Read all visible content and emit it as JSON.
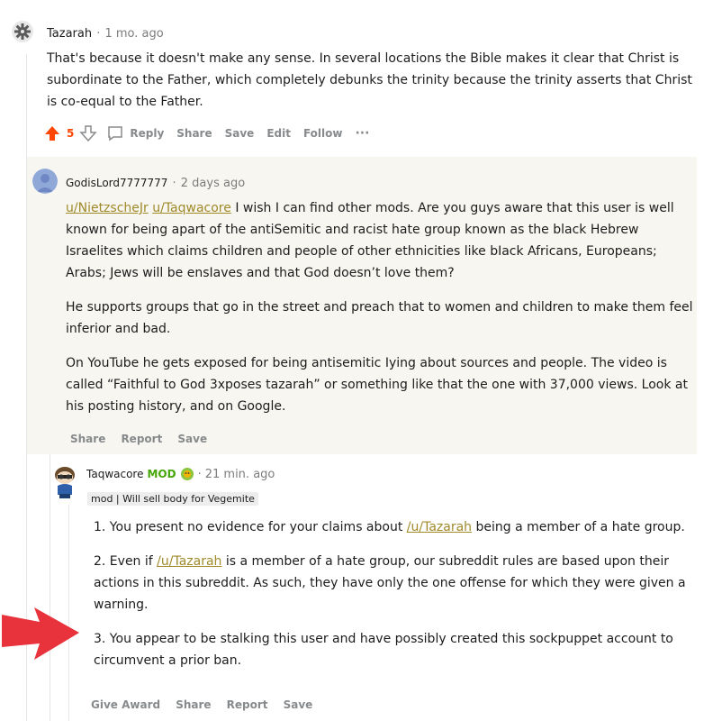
{
  "comment1": {
    "author": "Tazarah",
    "separator": "·",
    "time": "1 mo. ago",
    "text": "That's because it doesn't make any sense. In several locations the Bible makes it clear that Christ is subordinate to the Father, which completely debunks the trinity because the trinity asserts that Christ is co-equal to the Father.",
    "score": "5",
    "actions": [
      "Reply",
      "Share",
      "Save",
      "Edit",
      "Follow",
      "···"
    ]
  },
  "comment2": {
    "author": "GodisLord7777777",
    "separator": "·",
    "time": "2 days ago",
    "mention1": "u/NietzscheJr",
    "mention2": "u/Taqwacore",
    "para1_rest": "I wish I can find other mods. Are you guys aware that this user is well known for being apart of the antiSemitic and racist hate group known as the black Hebrew Israelites which claims children and people of other ethnicities like bIack Africans, Europeans; Arabs; Jews will be ensIaves and that God doesn’t love them?",
    "para2": "He supports groups that go in the street and preach that to women and children to make them feel inferior and bad.",
    "para3": "On YouTube he gets exposed for being antisemitic Iying about sources and people. The video is called “Faithful to God 3xposes tazarah” or something like that the one with 37,000 views. Look at his posting history, and on Google.",
    "actions": [
      "Share",
      "Report",
      "Save"
    ]
  },
  "comment3": {
    "author": "Taqwacore",
    "mod_label": "MOD",
    "separator": "·",
    "time": "21 min. ago",
    "flair": "mod | Will sell body for Vegemite",
    "item1_pre": "1. You present no evidence for your claims about ",
    "item1_link": "/u/Tazarah",
    "item1_post": " being a member of a hate group.",
    "item2_pre": "2. Even if ",
    "item2_link": "/u/Tazarah",
    "item2_post": " is a member of a hate group, our subreddit rules are based upon their actions in this subreddit. As such, they have only the one offense for which they were given a warning.",
    "item3": "3. You appear to be stalking this user and have possibly created this sockpuppet account to circumvent a prior ban.",
    "actions": [
      "Give Award",
      "Share",
      "Report",
      "Save"
    ]
  },
  "colors": {
    "upvote": "#ff4500",
    "arrow": "#e8323c",
    "highlight_bg": "#f7f6f1",
    "link": "#a08a2a",
    "mod_green": "#46a508"
  }
}
